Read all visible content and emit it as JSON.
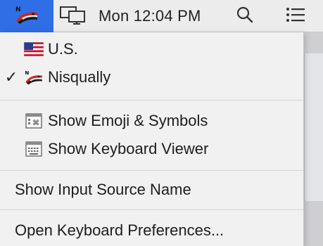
{
  "menubar": {
    "clock": "Mon 12:04 PM",
    "icons": {
      "input_source": "nisqually-flag-icon",
      "display": "display-mirroring-icon",
      "search": "spotlight-search-icon",
      "notifications": "notification-center-icon"
    },
    "accent_color": "#2f6ee4"
  },
  "menu": {
    "sources": [
      {
        "label": "U.S.",
        "icon": "us-flag-icon",
        "checked": false
      },
      {
        "label": "Nisqually",
        "icon": "nisqually-flag-icon",
        "checked": true
      }
    ],
    "check_mark": "✓",
    "tools": [
      {
        "label": "Show Emoji & Symbols",
        "icon": "emoji-symbols-icon"
      },
      {
        "label": "Show Keyboard Viewer",
        "icon": "keyboard-viewer-icon"
      }
    ],
    "show_input_source_name": "Show Input Source Name",
    "open_keyboard_preferences": "Open Keyboard Preferences..."
  }
}
